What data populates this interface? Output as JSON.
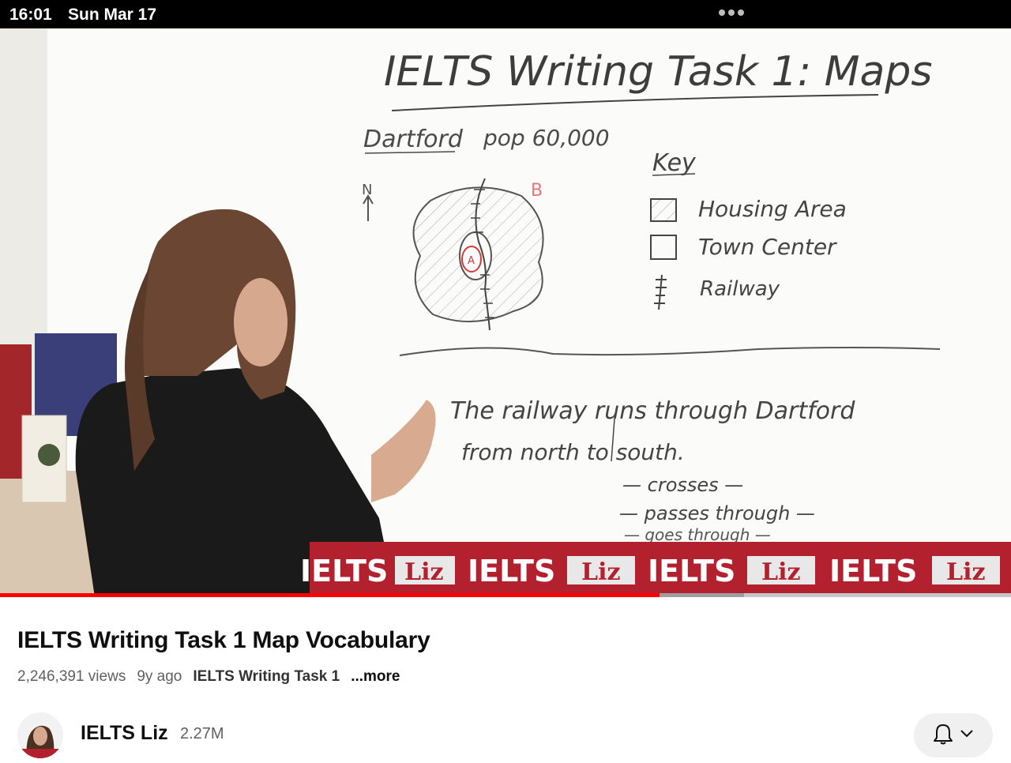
{
  "status_bar": {
    "time": "16:01",
    "date": "Sun Mar 17"
  },
  "video": {
    "board_title": "IELTS Writing Task 1: Maps",
    "town_label": "Dartford",
    "population": "pop 60,000",
    "north_label": "N",
    "point_a": "A",
    "point_b": "B",
    "key": {
      "title": "Key",
      "items": [
        "Housing Area",
        "Town Center",
        "Railway"
      ]
    },
    "sentence_line1": "The railway runs through Dartford",
    "sentence_line2": "from north to south.",
    "synonyms": [
      "— crosses —",
      "— passes through —",
      "— goes through —"
    ],
    "banner_text": "IELTS",
    "banner_name": "Liz",
    "progress_played": 0.652,
    "progress_buffered": 0.736
  },
  "title": "IELTS Writing Task 1 Map Vocabulary",
  "views": "2,246,391 views",
  "age": "9y ago",
  "tag": "IELTS Writing Task 1",
  "more": "...more",
  "channel": {
    "name": "IELTS Liz",
    "subscribers": "2.27M"
  },
  "icons": {
    "notification": "bell-icon",
    "dropdown": "chevron-down-icon"
  },
  "colors": {
    "progress": "#ff0000",
    "banner": "#b3212e"
  }
}
